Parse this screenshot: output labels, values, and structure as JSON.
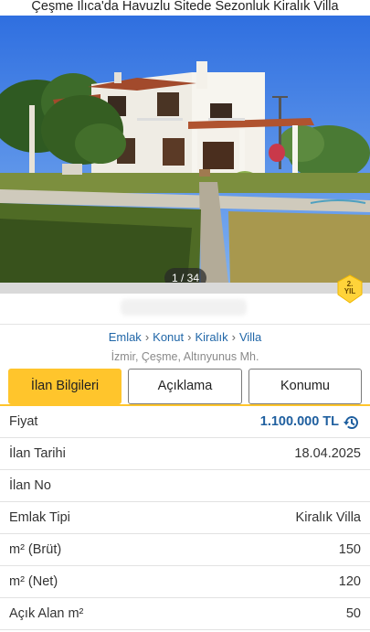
{
  "page": {
    "title": "Çeşme Ilıca'da Havuzlu Sitede Sezonluk Kiralık Villa"
  },
  "gallery": {
    "counter": "1 / 34"
  },
  "badge": {
    "line1": "2.",
    "line2": "YIL"
  },
  "breadcrumb": {
    "items": [
      "Emlak",
      "Konut",
      "Kiralık",
      "Villa"
    ],
    "separator": "›"
  },
  "location": "İzmir, Çeşme, Altınyunus Mh.",
  "tabs": [
    {
      "label": "İlan Bilgileri",
      "active": true
    },
    {
      "label": "Açıklama",
      "active": false
    },
    {
      "label": "Konumu",
      "active": false
    }
  ],
  "details": [
    {
      "label": "Fiyat",
      "value": "1.100.000 TL"
    },
    {
      "label": "İlan Tarihi",
      "value": "18.04.2025"
    },
    {
      "label": "İlan No",
      "value": ""
    },
    {
      "label": "Emlak Tipi",
      "value": "Kiralık Villa"
    },
    {
      "label": "m² (Brüt)",
      "value": "150"
    },
    {
      "label": "m² (Net)",
      "value": "120"
    },
    {
      "label": "Açık Alan m²",
      "value": "50"
    }
  ],
  "colors": {
    "accent": "#ffc52c",
    "link": "#2167a8",
    "price": "#1f5f9f"
  }
}
